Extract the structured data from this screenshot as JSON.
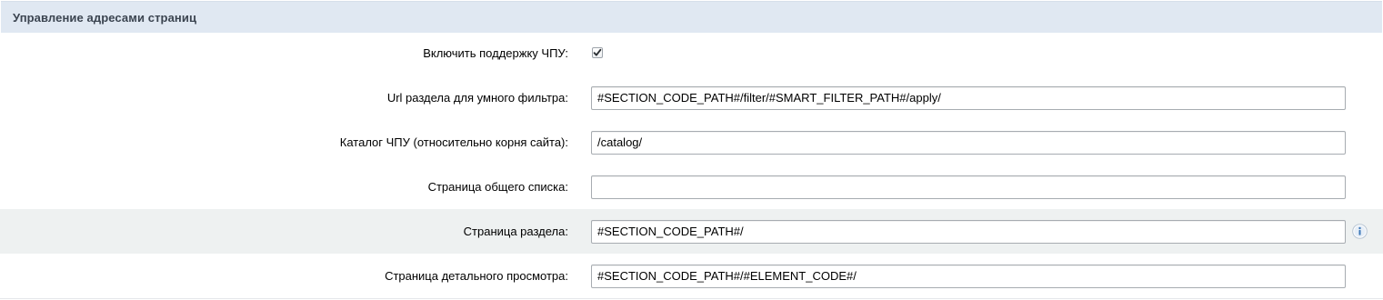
{
  "section": {
    "title": "Управление адресами страниц"
  },
  "fields": {
    "sef_mode": {
      "label": "Включить поддержку ЧПУ:",
      "checked": true
    },
    "smart_filter_url": {
      "label": "Url раздела для умного фильтра:",
      "value": "#SECTION_CODE_PATH#/filter/#SMART_FILTER_PATH#/apply/"
    },
    "sef_folder": {
      "label": "Каталог ЧПУ (относительно корня сайта):",
      "value": "/catalog/"
    },
    "list_page": {
      "label": "Страница общего списка:",
      "value": ""
    },
    "section_page": {
      "label": "Страница раздела:",
      "value": "#SECTION_CODE_PATH#/",
      "help_icon": "info-icon"
    },
    "detail_page": {
      "label": "Страница детального просмотра:",
      "value": "#SECTION_CODE_PATH#/#ELEMENT_CODE#/"
    }
  },
  "colors": {
    "header_bg": "#e0e8f2",
    "highlight_row_bg": "#eef1f1",
    "info_icon": "#3d78b8"
  }
}
